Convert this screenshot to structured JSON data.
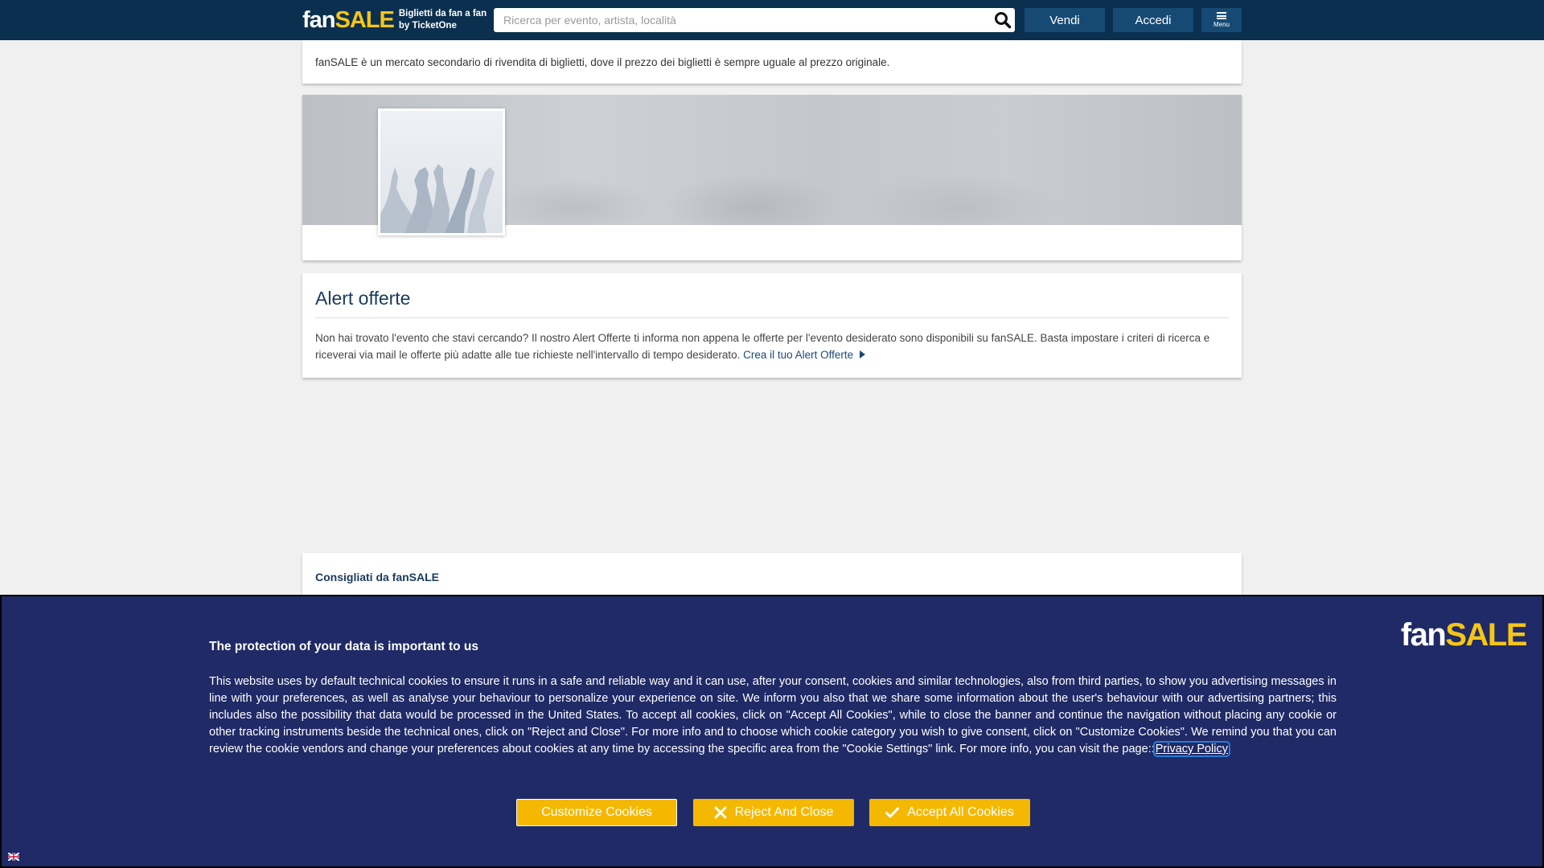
{
  "header": {
    "logo_fan": "fan",
    "logo_sale": "SALE",
    "tagline_line1": "Biglietti da fan a fan",
    "tagline_line2": "by TicketOne",
    "search_placeholder": "Ricerca per evento, artista, località",
    "sell_label": "Vendi",
    "login_label": "Accedi",
    "menu_label": "Menu"
  },
  "info": {
    "text": "fanSALE è un mercato secondario di rivendita di biglietti, dove il prezzo dei biglietti è sempre uguale al prezzo originale."
  },
  "alert": {
    "title": "Alert offerte",
    "text": "Non hai trovato l'evento che stavi cercando? Il nostro Alert Offerte ti informa non appena le offerte per l'evento desiderato sono disponibili su fanSALE. Basta impostare i criteri di ricerca e riceverai via mail le offerte più adatte alle tue richieste nell'intervallo di tempo desiderato.",
    "link_label": "Crea il tuo Alert Offerte"
  },
  "recommended": {
    "title": "Consigliati da fanSALE"
  },
  "cookie": {
    "logo_fan": "fan",
    "logo_sale": "SALE",
    "title": "The protection of your data is important to us",
    "text": "This website uses by default technical cookies to ensure it runs in a safe and reliable way and it can use, after your consent, cookies and similar technologies, also from third parties, to show you advertising messages in line with your preferences, as well as analyse your behaviour to personalize your experience on site. We inform you also that we share some information about the user's behaviour with our advertising partners; this includes also the possibility that data would be processed in the United States. To accept all cookies, click on \"Accept All Cookies\", while to close the banner and continue the navigation without placing any cookie or other tracking instruments beside the technical ones, click on \"Reject and Close\". For more info and to choose which cookie category you wish to give consent, click on \"Customize Cookies\". We remind you that you can review the cookie vendors and change your preferences about cookies at any time by accessing the specific area from the \"Cookie Settings\" link. For more info, you can visit the page::",
    "privacy_link": "Privacy Policy",
    "customize_label": "Customize Cookies",
    "reject_label": "Reject And Close",
    "accept_label": "Accept All Cookies"
  },
  "colors": {
    "header_bg": "#0b2f4e",
    "brand_yellow": "#f5c518",
    "cookie_bg": "#1f2a66",
    "button_yellow": "#f5b800"
  }
}
